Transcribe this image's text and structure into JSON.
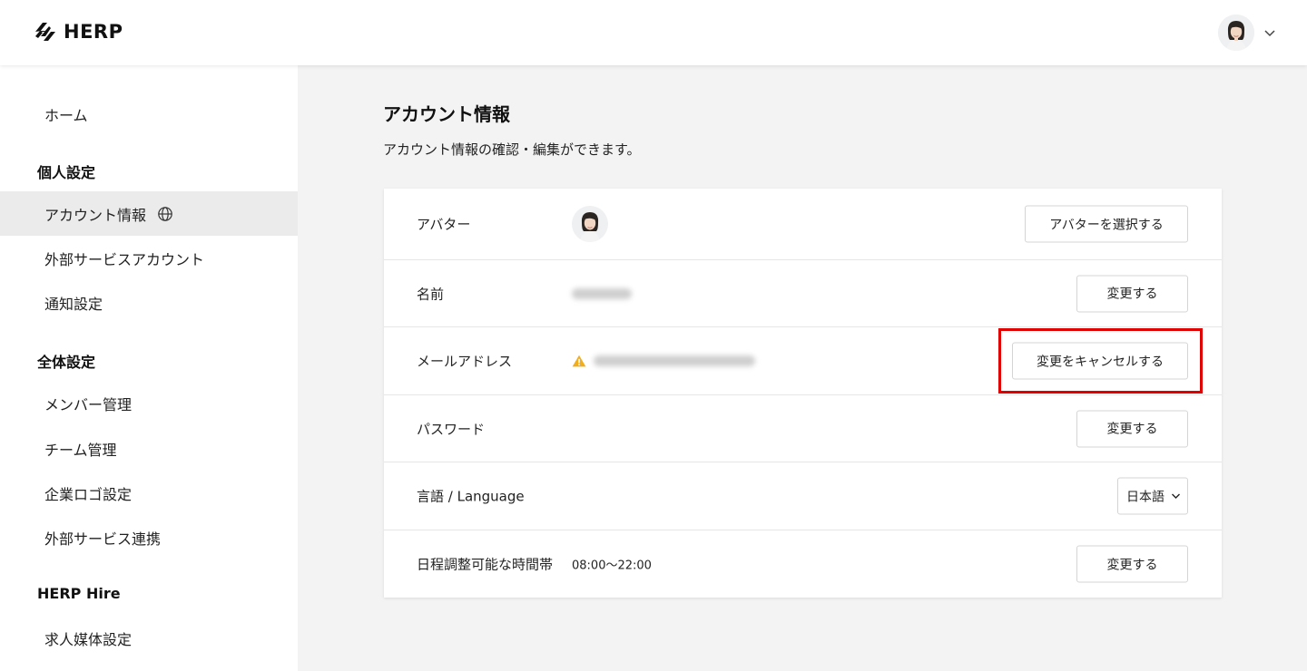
{
  "header": {
    "logo_text": "HERP",
    "logo_icon": "herp-logo-icon",
    "avatar_icon": "user-avatar",
    "menu_icon": "chevron-down-icon"
  },
  "sidebar": {
    "home": "ホーム",
    "personal_heading": "個人設定",
    "account_info": "アカウント情報",
    "external_accounts": "外部サービスアカウント",
    "notifications": "通知設定",
    "global_heading": "全体設定",
    "members": "メンバー管理",
    "teams": "チーム管理",
    "logo_settings": "企業ロゴ設定",
    "integrations": "外部サービス連携",
    "hire_heading": "HERP Hire",
    "job_media": "求人媒体設定"
  },
  "main": {
    "title": "アカウント情報",
    "description": "アカウント情報の確認・編集ができます。"
  },
  "rows": {
    "avatar": {
      "label": "アバター",
      "button": "アバターを選択する"
    },
    "name": {
      "label": "名前",
      "button": "変更する"
    },
    "email": {
      "label": "メールアドレス",
      "button": "変更をキャンセルする"
    },
    "password": {
      "label": "パスワード",
      "button": "変更する"
    },
    "language": {
      "label": "言語 / Language",
      "selected": "日本語"
    },
    "schedule": {
      "label": "日程調整可能な時間帯",
      "value": "08:00〜22:00",
      "button": "変更する"
    }
  },
  "colors": {
    "highlight": "#e00000",
    "warning": "#f0ad1e",
    "active_item_bg": "#ebebeb"
  }
}
